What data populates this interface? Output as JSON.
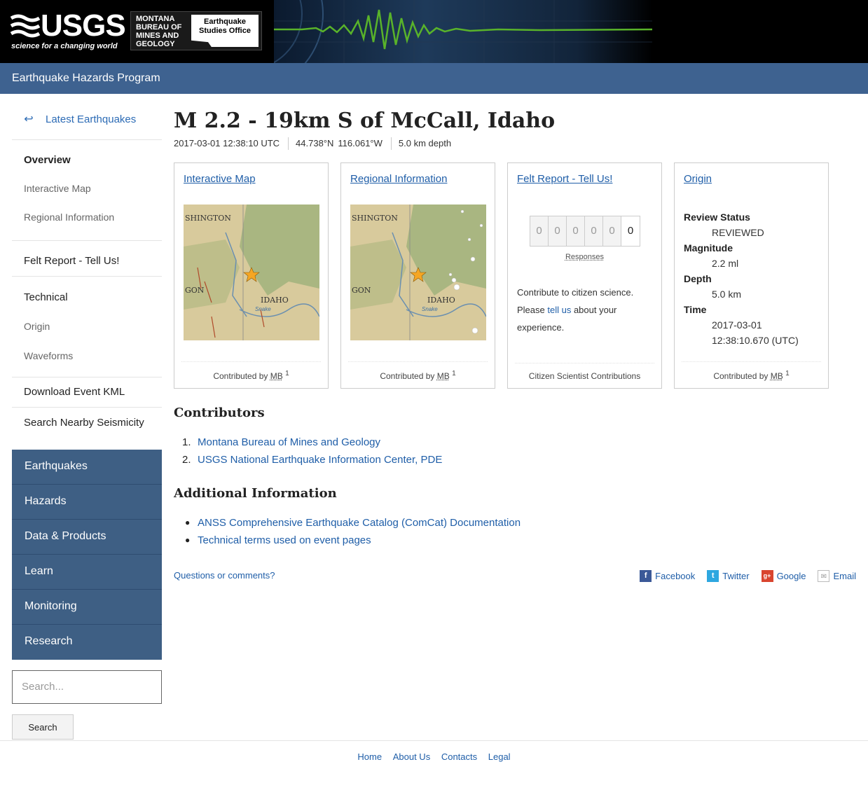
{
  "banner": {
    "usgs_word": "USGS",
    "usgs_tagline": "science for a changing world",
    "mbmg_text": "Montana Bureau of Mines and Geology",
    "office_text": "Earthquake Studies Office"
  },
  "program_bar": "Earthquake Hazards Program",
  "sidebar": {
    "back_label": "Latest Earthquakes",
    "overview": "Overview",
    "interactive_map": "Interactive Map",
    "regional_information": "Regional Information",
    "felt_report": "Felt Report - Tell Us!",
    "technical": "Technical",
    "origin": "Origin",
    "waveforms": "Waveforms",
    "download_kml": "Download Event KML",
    "search_nearby": "Search Nearby Seismicity",
    "site_nav": [
      "Earthquakes",
      "Hazards",
      "Data & Products",
      "Learn",
      "Monitoring",
      "Research"
    ],
    "search_placeholder": "Search...",
    "search_button": "Search"
  },
  "event": {
    "title": "M 2.2 - 19km S of McCall, Idaho",
    "time": "2017-03-01 12:38:10 UTC",
    "lat": "44.738°N",
    "lon": "116.061°W",
    "depth": "5.0 km depth"
  },
  "cards": {
    "interactive_map": {
      "title": "Interactive Map",
      "contrib": "Contributed by",
      "source": "MB",
      "sup": "1"
    },
    "regional_information": {
      "title": "Regional Information",
      "contrib": "Contributed by",
      "source": "MB",
      "sup": "1"
    },
    "felt_report": {
      "title": "Felt Report - Tell Us!",
      "digits": [
        "0",
        "0",
        "0",
        "0",
        "0",
        "0"
      ],
      "responses_label": "Responses",
      "text_before": "Contribute to citizen science. Please ",
      "link_text": "tell us",
      "text_after": " about your experience.",
      "footer": "Citizen Scientist Contributions"
    },
    "origin": {
      "title": "Origin",
      "review_status_label": "Review Status",
      "review_status": "REVIEWED",
      "magnitude_label": "Magnitude",
      "magnitude": "2.2 ml",
      "depth_label": "Depth",
      "depth": "5.0 km",
      "time_label": "Time",
      "time_date": "2017-03-01",
      "time_clock": "12:38:10.670 (UTC)",
      "contrib": "Contributed by",
      "source": "MB",
      "sup": "1"
    }
  },
  "map_labels": {
    "state1": "SHINGTON",
    "state2": "GON",
    "state3": "IDAHO",
    "river": "Snake"
  },
  "contributors": {
    "heading": "Contributors",
    "items": [
      "Montana Bureau of Mines and Geology",
      "USGS National Earthquake Information Center, PDE"
    ]
  },
  "additional": {
    "heading": "Additional Information",
    "items": [
      "ANSS Comprehensive Earthquake Catalog (ComCat) Documentation",
      "Technical terms used on event pages"
    ]
  },
  "questions": "Questions or comments?",
  "social": {
    "facebook": "Facebook",
    "twitter": "Twitter",
    "google": "Google",
    "email": "Email"
  },
  "footer": {
    "home": "Home",
    "about": "About Us",
    "contacts": "Contacts",
    "legal": "Legal"
  },
  "colors": {
    "banner": "#000000",
    "program_bar": "#3e6290",
    "site_nav": "#3e5f84",
    "link": "#1f5ea8"
  }
}
